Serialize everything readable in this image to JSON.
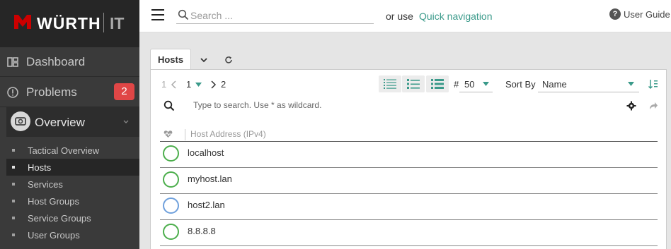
{
  "brand": {
    "name": "WÜRTH",
    "suffix": "IT",
    "accent": "#cc0000"
  },
  "sidebar": {
    "items": [
      {
        "label": "Dashboard",
        "icon": "dashboard-icon"
      },
      {
        "label": "Problems",
        "icon": "problems-icon",
        "badge": "2"
      }
    ],
    "overview": {
      "label": "Overview",
      "icon": "camera-icon"
    },
    "subitems": [
      {
        "label": "Tactical Overview"
      },
      {
        "label": "Hosts",
        "active": true
      },
      {
        "label": "Services"
      },
      {
        "label": "Host Groups"
      },
      {
        "label": "Service Groups"
      },
      {
        "label": "User Groups"
      }
    ]
  },
  "topbar": {
    "search_placeholder": "Search ...",
    "or_use": "or use",
    "quick_nav": "Quick navigation",
    "user_guide": "User Guide"
  },
  "tabs": {
    "active": "Hosts"
  },
  "pager": {
    "first": "1",
    "current": "1",
    "last": "2"
  },
  "toolbar": {
    "hash": "#",
    "limit": "50",
    "sort_label": "Sort By",
    "sort_value": "Name"
  },
  "filter": {
    "placeholder": "Type to search. Use * as wildcard."
  },
  "table": {
    "header": "Host Address (IPv4)",
    "rows": [
      {
        "name": "localhost",
        "state_color": "#4cae4c"
      },
      {
        "name": "myhost.lan",
        "state_color": "#4cae4c"
      },
      {
        "name": "host2.lan",
        "state_color": "#6fa0dc"
      },
      {
        "name": "8.8.8.8",
        "state_color": "#4cae4c"
      }
    ]
  }
}
